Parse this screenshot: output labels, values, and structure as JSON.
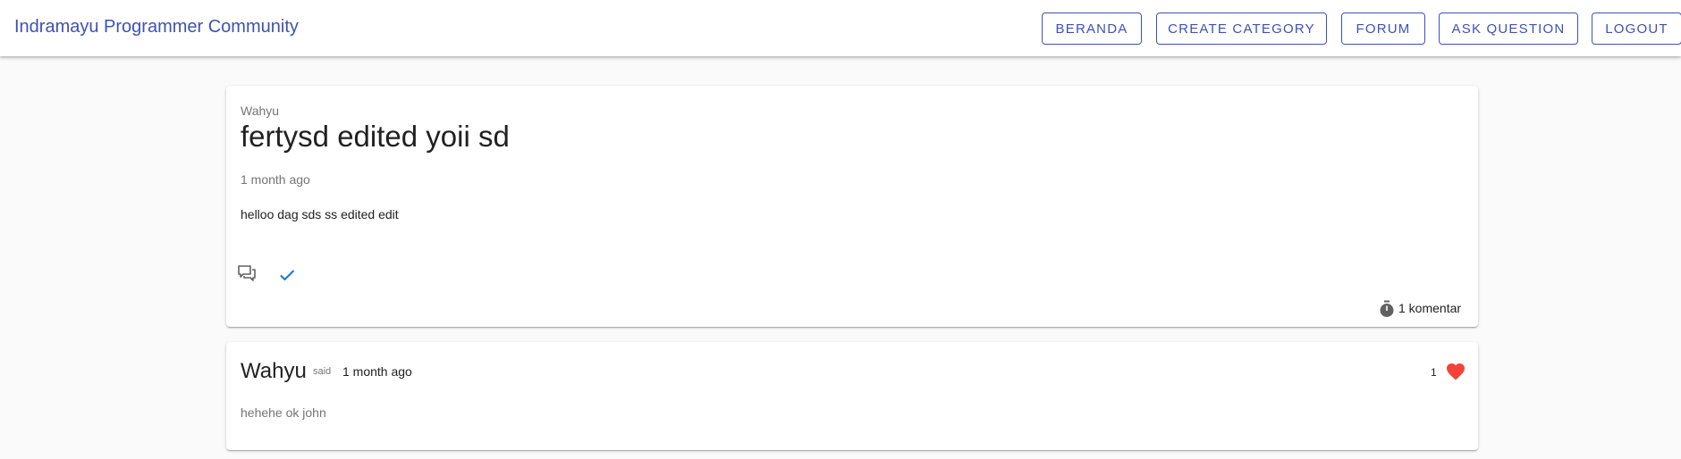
{
  "app": {
    "title": "Indramayu Programmer Community"
  },
  "nav": {
    "items": [
      {
        "label": "Beranda"
      },
      {
        "label": "Create Category"
      },
      {
        "label": "Forum"
      },
      {
        "label": "Ask Question"
      },
      {
        "label": "Logout"
      }
    ]
  },
  "post": {
    "author": "Wahyu",
    "title": "fertysd edited yoii sd",
    "time": "1 month ago",
    "body": "helloo dag sds ss edited edit",
    "comment_count": "1 komentar",
    "icons": {
      "comments": "comments-icon",
      "check": "check-icon",
      "timer": "timer-icon"
    }
  },
  "comment": {
    "author": "Wahyu",
    "said": "said",
    "time": "1 month ago",
    "body": "hehehe ok john",
    "likes": "1",
    "icons": {
      "like": "heart-icon"
    }
  },
  "colors": {
    "primary": "#3f51b5",
    "check": "#1976d2",
    "heart": "#f44336",
    "muted": "#757575"
  }
}
